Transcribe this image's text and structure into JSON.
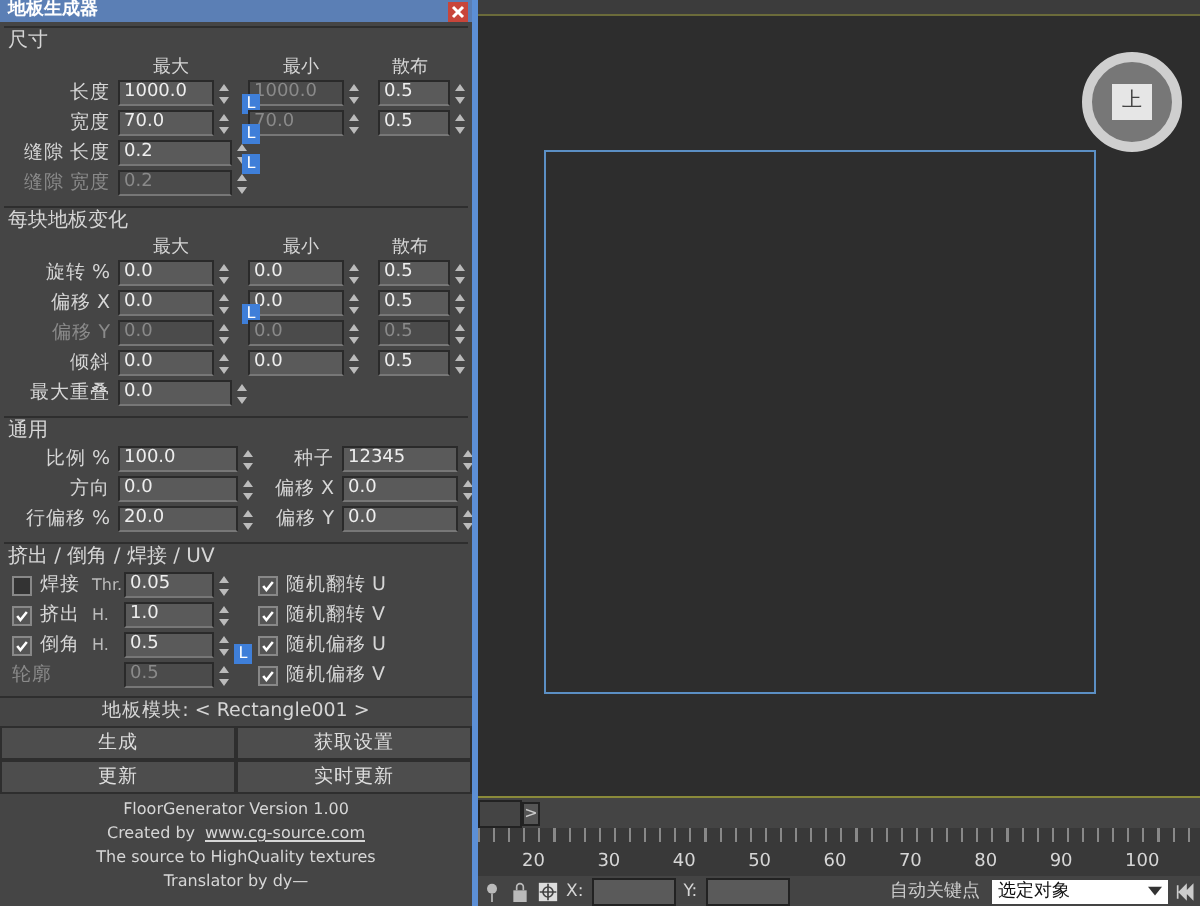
{
  "window": {
    "title": "地板生成器"
  },
  "size": {
    "title": "尺寸",
    "headers": [
      "最大",
      "最小",
      "散布"
    ],
    "rows": [
      {
        "label": "长度",
        "disabled": false,
        "lock": "L",
        "fields": [
          {
            "value": "1000.0",
            "disabled": false
          },
          {
            "value": "1000.0",
            "disabled": true
          },
          {
            "value": "0.5",
            "disabled": false
          }
        ]
      },
      {
        "label": "宽度",
        "disabled": false,
        "lock": "L",
        "fields": [
          {
            "value": "70.0",
            "disabled": false
          },
          {
            "value": "70.0",
            "disabled": true
          },
          {
            "value": "0.5",
            "disabled": false
          }
        ]
      },
      {
        "label": "缝隙 长度",
        "disabled": false,
        "lock": "L",
        "fields": [
          {
            "value": "0.2",
            "disabled": false
          }
        ]
      },
      {
        "label": "缝隙 宽度",
        "disabled": true,
        "fields": [
          {
            "value": "0.2",
            "disabled": true
          }
        ]
      }
    ]
  },
  "variation": {
    "title": "每块地板变化",
    "headers": [
      "最大",
      "最小",
      "散布"
    ],
    "rows": [
      {
        "label": "旋转 %",
        "disabled": false,
        "fields": [
          {
            "value": "0.0",
            "disabled": false
          },
          {
            "value": "0.0",
            "disabled": false
          },
          {
            "value": "0.5",
            "disabled": false
          }
        ]
      },
      {
        "label": "偏移 X",
        "disabled": false,
        "lock": "L",
        "fields": [
          {
            "value": "0.0",
            "disabled": false
          },
          {
            "value": "0.0",
            "disabled": false
          },
          {
            "value": "0.5",
            "disabled": false
          }
        ]
      },
      {
        "label": "偏移 Y",
        "disabled": true,
        "fields": [
          {
            "value": "0.0",
            "disabled": true
          },
          {
            "value": "0.0",
            "disabled": true
          },
          {
            "value": "0.5",
            "disabled": true
          }
        ]
      },
      {
        "label": "倾斜",
        "disabled": false,
        "fields": [
          {
            "value": "0.0",
            "disabled": false
          },
          {
            "value": "0.0",
            "disabled": false
          },
          {
            "value": "0.5",
            "disabled": false
          }
        ]
      },
      {
        "label": "最大重叠",
        "disabled": false,
        "fields": [
          {
            "value": "0.0",
            "disabled": false
          }
        ]
      }
    ]
  },
  "general": {
    "title": "通用",
    "rows": [
      {
        "label": "比例 %",
        "value": "100.0",
        "right_label": "种子",
        "right_value": "12345"
      },
      {
        "label": "方向",
        "value": "0.0",
        "right_label": "偏移 X",
        "right_value": "0.0"
      },
      {
        "label": "行偏移 %",
        "value": "20.0",
        "right_label": "偏移 Y",
        "right_value": "0.0"
      }
    ]
  },
  "extrude": {
    "title": "挤出 / 倒角 / 焊接 / UV",
    "rows": [
      {
        "kind": "check",
        "label": "焊接",
        "checked": false,
        "param": "Thr.",
        "value": "0.05",
        "disabled": false,
        "option": {
          "label": "随机翻转 U",
          "checked": true
        }
      },
      {
        "kind": "check",
        "label": "挤出",
        "checked": true,
        "param": "H.",
        "value": "1.0",
        "disabled": false,
        "option": {
          "label": "随机翻转 V",
          "checked": true
        }
      },
      {
        "kind": "check",
        "label": "倒角",
        "checked": true,
        "param": "H.",
        "value": "0.5",
        "disabled": false,
        "lock": "L",
        "option": {
          "label": "随机偏移 U",
          "checked": true
        }
      },
      {
        "kind": "plain",
        "label": "轮廓",
        "value": "0.5",
        "disabled": true,
        "option": {
          "label": "随机偏移 V",
          "checked": true
        }
      }
    ]
  },
  "module_label": "地板模块: < Rectangle001 >",
  "button_rows": [
    {
      "buttons": [
        "生成",
        "获取设置"
      ]
    },
    {
      "buttons": [
        "更新",
        "实时更新"
      ]
    }
  ],
  "credits": {
    "version": "FloorGenerator Version 1.00",
    "created_by": "Created by",
    "link": "www.cg-source.com",
    "tagline": "The source to HighQuality textures",
    "translator": "Translator by dy—"
  },
  "viewport": {
    "viewcube_label": "上"
  },
  "timeline": {
    "next": ">",
    "ticks": [
      "20",
      "30",
      "40",
      "50",
      "60",
      "70",
      "80",
      "90",
      "100"
    ]
  },
  "status_bar": {
    "x_label": "X:",
    "y_label": "Y:",
    "auto_key": "自动关键点",
    "selection": "选定对象"
  }
}
